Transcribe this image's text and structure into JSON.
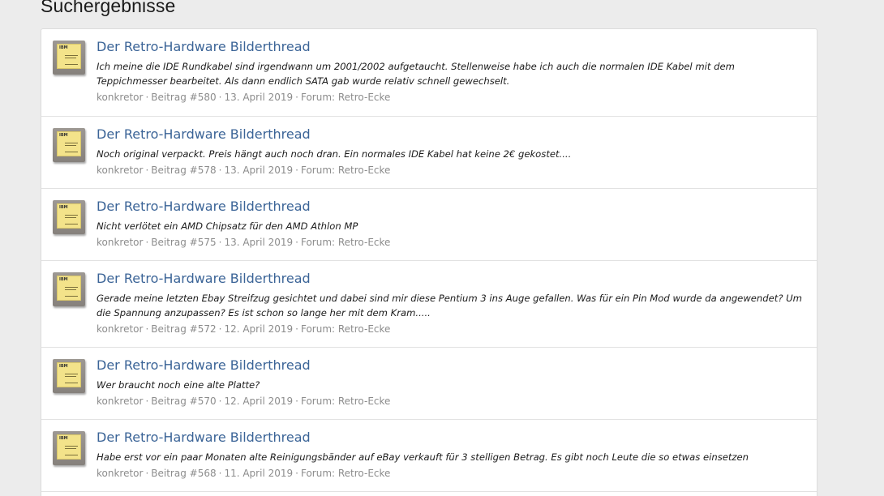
{
  "page": {
    "title": "Suchergebnisse"
  },
  "results": [
    {
      "title": "Der Retro-Hardware Bilderthread",
      "snippet": "Ich meine die IDE Rundkabel sind irgendwann um 2001/2002 aufgetaucht. Stellenweise habe ich auch die normalen IDE Kabel mit dem Teppichmesser bearbeitet. Als dann endlich SATA gab wurde relativ schnell gewechselt.",
      "author": "konkretor",
      "post": "Beitrag #580",
      "date": "13. April 2019",
      "forum": "Forum: Retro-Ecke"
    },
    {
      "title": "Der Retro-Hardware Bilderthread",
      "snippet": "Noch original verpackt. Preis hängt auch noch dran. Ein normales IDE Kabel hat keine 2€ gekostet....",
      "author": "konkretor",
      "post": "Beitrag #578",
      "date": "13. April 2019",
      "forum": "Forum: Retro-Ecke"
    },
    {
      "title": "Der Retro-Hardware Bilderthread",
      "snippet": "Nicht verlötet ein AMD Chipsatz für den AMD Athlon MP",
      "author": "konkretor",
      "post": "Beitrag #575",
      "date": "13. April 2019",
      "forum": "Forum: Retro-Ecke"
    },
    {
      "title": "Der Retro-Hardware Bilderthread",
      "snippet": "Gerade meine letzten Ebay Streifzug gesichtet und dabei sind mir diese Pentium 3 ins Auge gefallen. Was für ein Pin Mod wurde da angewendet? Um die Spannung anzupassen? Es ist schon so lange her mit dem Kram.....",
      "author": "konkretor",
      "post": "Beitrag #572",
      "date": "12. April 2019",
      "forum": "Forum: Retro-Ecke"
    },
    {
      "title": "Der Retro-Hardware Bilderthread",
      "snippet": "Wer braucht noch eine alte Platte?",
      "author": "konkretor",
      "post": "Beitrag #570",
      "date": "12. April 2019",
      "forum": "Forum: Retro-Ecke"
    },
    {
      "title": "Der Retro-Hardware Bilderthread",
      "snippet": "Habe erst vor ein paar Monaten alte Reinigungsbänder auf eBay verkauft für 3 stelligen Betrag. Es gibt noch Leute die so etwas einsetzen",
      "author": "konkretor",
      "post": "Beitrag #568",
      "date": "11. April 2019",
      "forum": "Forum: Retro-Ecke"
    }
  ],
  "avatar": {
    "brand_text": "IBM"
  },
  "separator": "·",
  "colors": {
    "link": "#3b6497",
    "meta": "#8c8c8c",
    "background": "#ececec",
    "panel": "#ffffff"
  }
}
